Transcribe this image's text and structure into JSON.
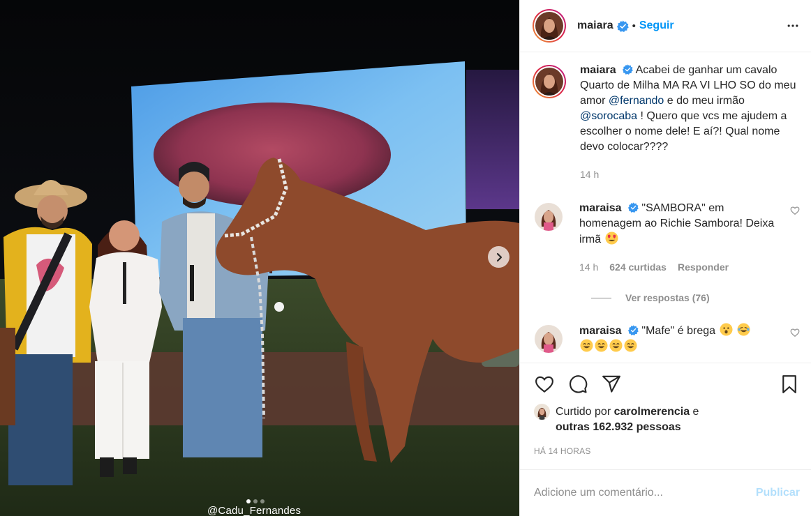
{
  "post": {
    "username": "maiara",
    "follow_label": "Seguir",
    "separator": "•",
    "photo_credit": "@Cadu_Fernandes",
    "carousel_total": 3,
    "carousel_active": 1,
    "icons": {
      "verified": "verified-badge-icon",
      "more": "more-options-icon",
      "next": "chevron-right-icon"
    }
  },
  "caption": {
    "username": "maiara",
    "text_before": "Acabei de ganhar um cavalo Quarto de Milha MA RA VI LHO SO do meu amor ",
    "mention1": "@fernando",
    "text_middle": " e do meu irmão ",
    "mention2": "@sorocaba",
    "text_after": " ! Quero que vcs me ajudem a escolher o nome dele! E aí?! Qual nome devo colocar????",
    "time": "14 h"
  },
  "comments": [
    {
      "username": "maraisa",
      "text": "\"SAMBORA\" em homenagem ao Richie Sambora! Deixa irmã",
      "emoji": "heart-eyes-emoji",
      "time": "14 h",
      "likes": "624 curtidas",
      "reply_label": "Responder",
      "view_replies": "Ver respostas (76)"
    },
    {
      "username": "maraisa",
      "text": "\"Mafe\" é brega",
      "emojis": [
        "surprised-emoji",
        "laughing-emoji",
        "grinning-emoji",
        "grinning-emoji",
        "grinning-emoji",
        "grinning-emoji"
      ]
    }
  ],
  "likes": {
    "prefix": "Curtido por ",
    "user": "carolmerencia",
    "conj": " e",
    "others": "outras 162.932 pessoas"
  },
  "time_ago": "HÁ 14 HORAS",
  "comment_box": {
    "placeholder": "Adicione um comentário...",
    "publish_label": "Publicar"
  },
  "colors": {
    "link": "#0095f6",
    "mention": "#00376b",
    "muted": "#8e8e8e",
    "publish_disabled": "#b2dffc"
  }
}
